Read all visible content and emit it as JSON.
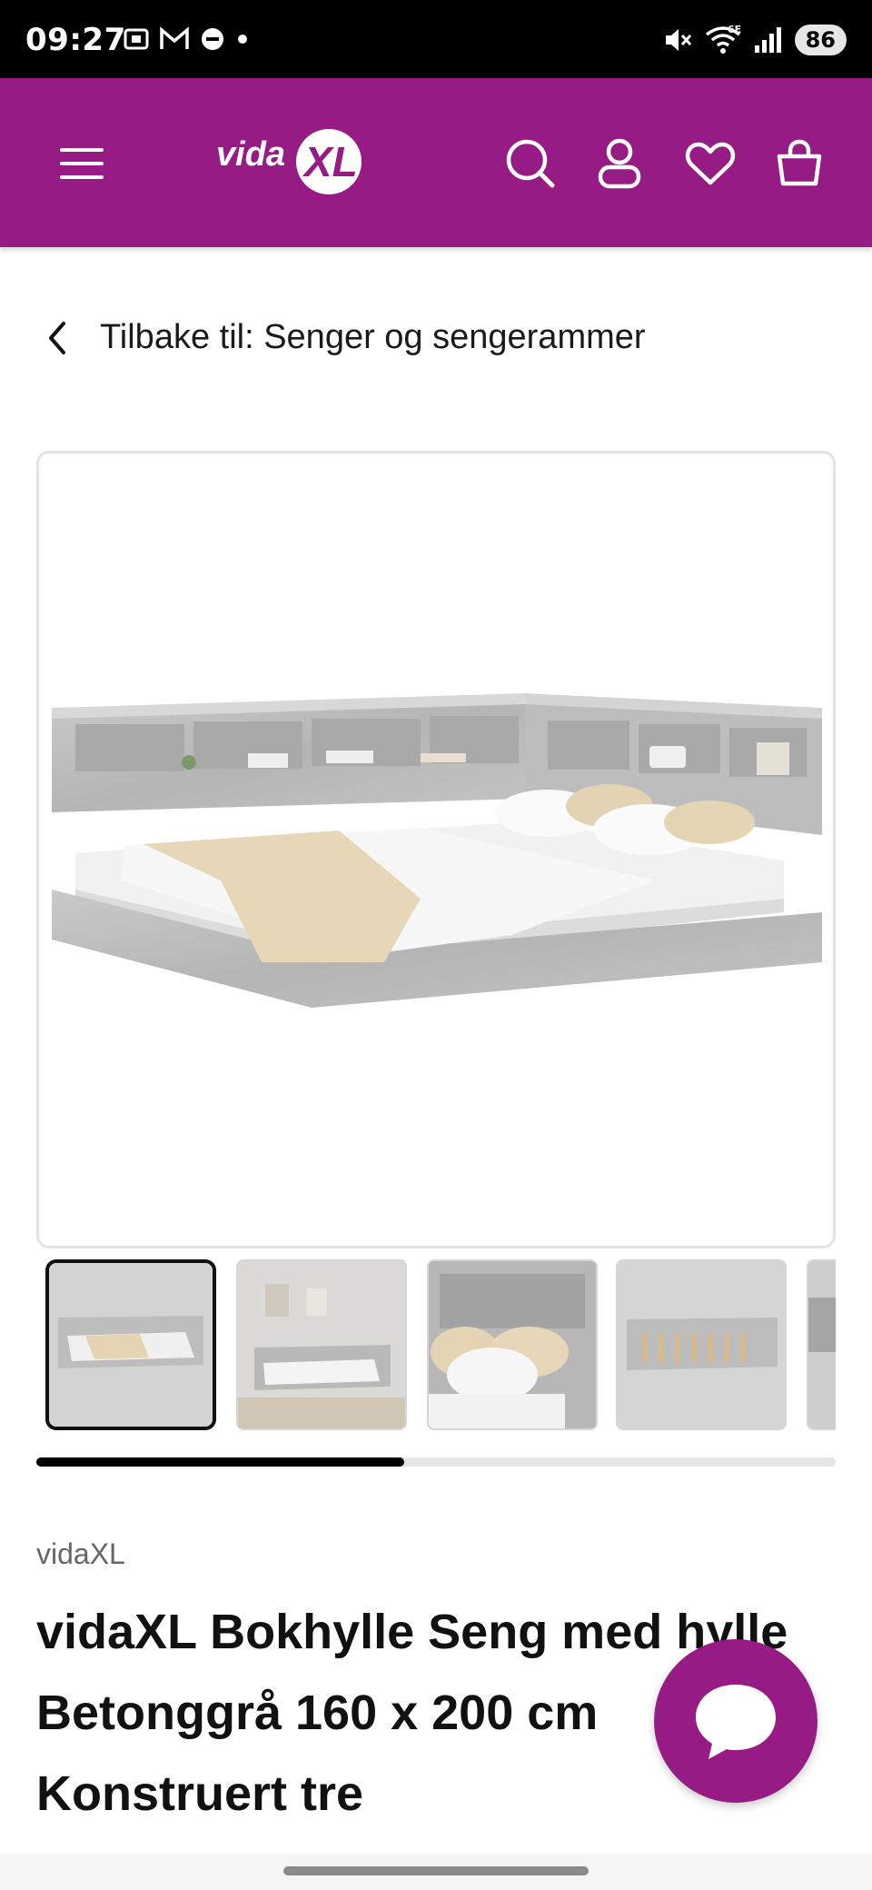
{
  "status_bar": {
    "time": "09:27",
    "battery": "86",
    "network": "6E",
    "icons": [
      "screenshot-icon",
      "gmail-icon",
      "app-icon",
      "dot-icon",
      "mute-icon",
      "wifi-icon",
      "signal-icon",
      "battery-icon"
    ]
  },
  "header": {
    "logo_text": "vidaXL",
    "icons": [
      "menu-icon",
      "search-icon",
      "account-icon",
      "wishlist-icon",
      "cart-icon"
    ],
    "accent": "#971b84"
  },
  "breadcrumb": {
    "label": "Tilbake til: Senger og sengerammer"
  },
  "gallery": {
    "thumbnail_count": 5,
    "active_index": 0,
    "scroll_progress": 0.46
  },
  "product": {
    "brand": "vidaXL",
    "title_lines": [
      "vidaXL Bokhylle Seng med hylle",
      "Betonggrå 160 x 200 cm",
      "Konstruert tre"
    ]
  },
  "chat": {
    "icon": "chat-bubble-icon"
  }
}
